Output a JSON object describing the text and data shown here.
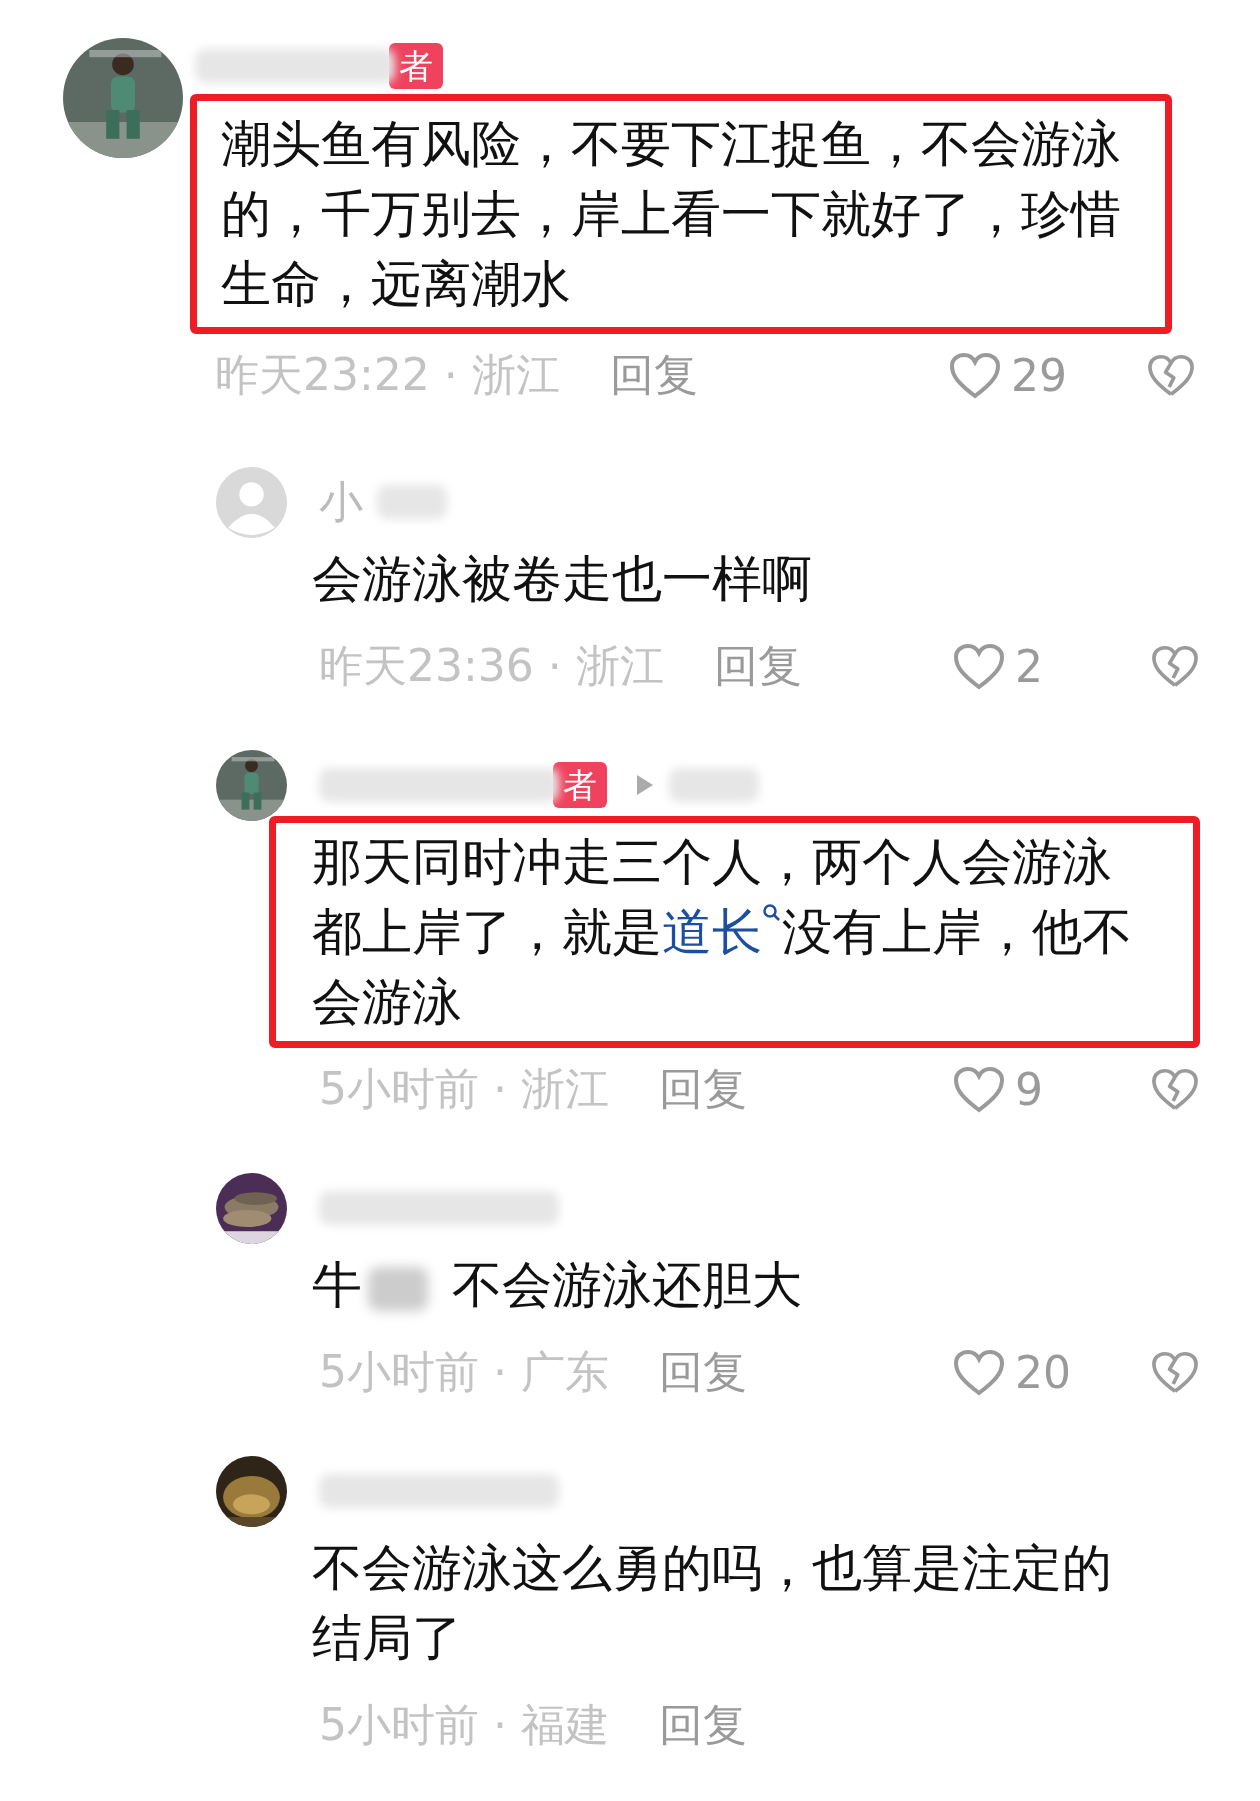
{
  "comments": [
    {
      "kind": "top",
      "badge": "者",
      "replying_to": false,
      "boxed": true,
      "text_parts": [
        {
          "kind": "plain",
          "text": "潮头鱼有风险，不要下江捉鱼，不会游泳的，千万别去，岸上看一下就好了，珍惜生命，远离潮水"
        }
      ],
      "time": "昨天23:22",
      "separator": "·",
      "region": "浙江",
      "reply": "回复",
      "likes": "29"
    },
    {
      "kind": "reply",
      "avatar": {
        "kind": "default"
      },
      "name": "小",
      "replying_to": false,
      "boxed": false,
      "text_parts": [
        {
          "kind": "plain",
          "text": "会游泳被卷走也一样啊"
        }
      ],
      "time": "昨天23:36",
      "separator": "·",
      "region": "浙江",
      "reply": "回复",
      "likes": "2"
    },
    {
      "kind": "reply",
      "badge": "者",
      "replying_to": true,
      "boxed": true,
      "text_parts": [
        {
          "kind": "plain",
          "text": "那天同时冲走三个人，两个人会游泳都上岸了，就是"
        },
        {
          "kind": "link",
          "text": "道长"
        },
        {
          "kind": "plain",
          "text": "没有上岸，他不会游泳"
        }
      ],
      "time": "5小时前",
      "separator": "·",
      "region": "浙江",
      "reply": "回复",
      "likes": "9"
    },
    {
      "kind": "reply",
      "replying_to": false,
      "boxed": false,
      "text_parts": [
        {
          "kind": "plain",
          "text": "牛"
        },
        {
          "kind": "blur"
        },
        {
          "kind": "plain",
          "text": "不会游泳还胆大"
        }
      ],
      "time": "5小时前",
      "separator": "·",
      "region": "广东",
      "reply": "回复",
      "likes": "20"
    },
    {
      "kind": "reply",
      "replying_to": false,
      "boxed": false,
      "text_parts": [
        {
          "kind": "plain",
          "text": "不会游泳这么勇的吗，也算是注定的结局了"
        }
      ],
      "time": "5小时前",
      "separator": "·",
      "region": "福建",
      "reply": "回复"
    }
  ]
}
